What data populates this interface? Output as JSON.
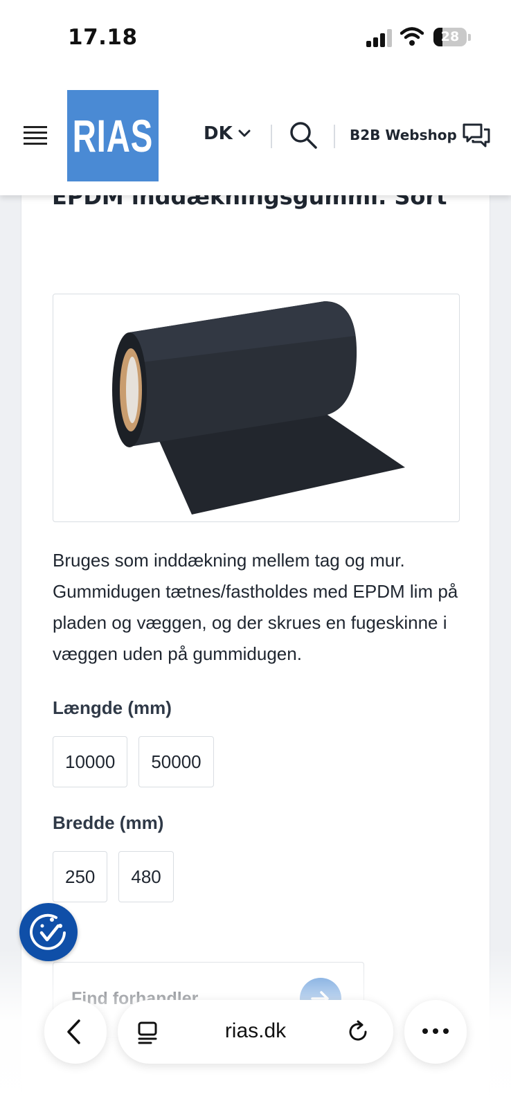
{
  "status_bar": {
    "time": "17.18",
    "battery": "28",
    "battery_level": 0.28
  },
  "header": {
    "logo_text": "RIAS",
    "language": "DK",
    "b2b_label": "B2B Webshop"
  },
  "product": {
    "title": "EPDM inddækningsgummi. Sort",
    "description": "Bruges som inddækning mellem tag og mur. Gummidugen tætnes/fastholdes med EPDM lim på pladen og væggen, og der skrues en fugeskinne i væggen uden på gummidugen.",
    "length": {
      "label": "Længde (mm)",
      "options": [
        "10000",
        "50000"
      ]
    },
    "width": {
      "label": "Bredde (mm)",
      "options": [
        "250",
        "480"
      ]
    },
    "find_dealer": "Find forhandler"
  },
  "browser": {
    "url": "rias.dk"
  },
  "colors": {
    "brand_blue": "#4a8ad4",
    "cookie_blue": "#0f4fa8"
  }
}
